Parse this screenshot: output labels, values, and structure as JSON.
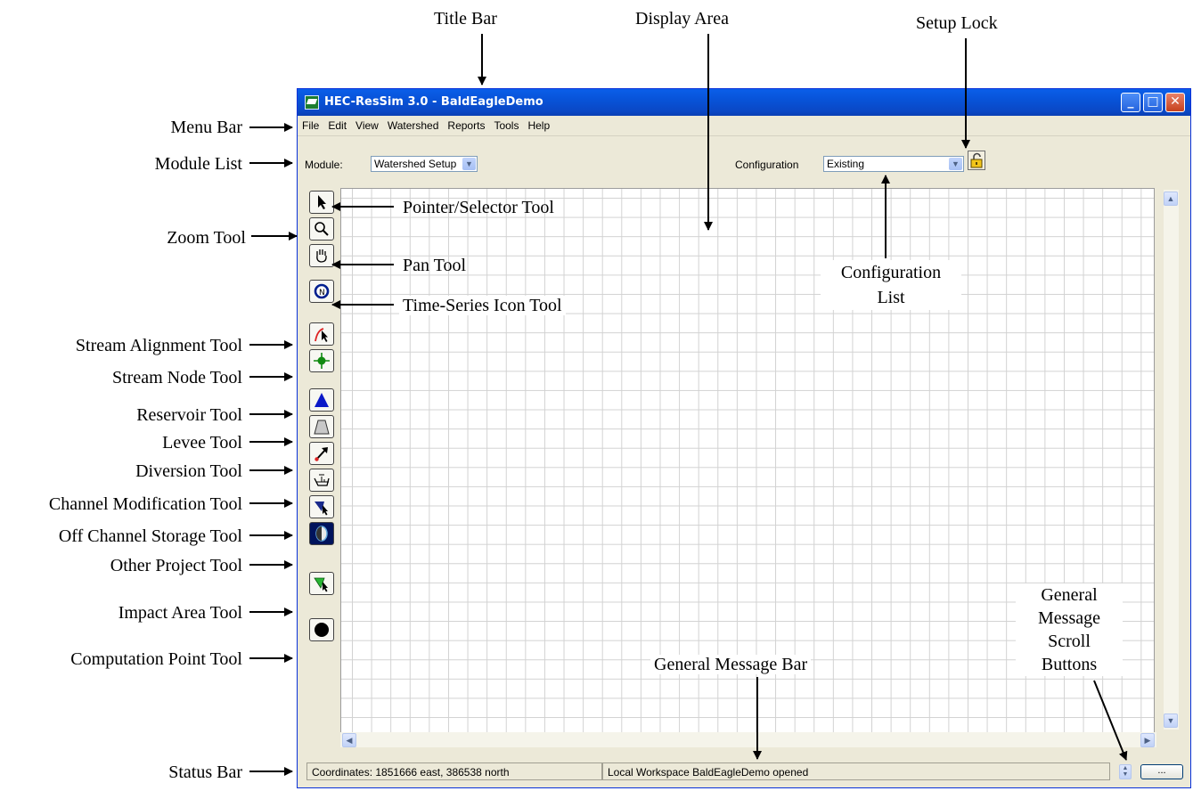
{
  "window": {
    "title": "HEC-ResSim 3.0  - BaldEagleDemo",
    "menu": [
      "File",
      "Edit",
      "View",
      "Watershed",
      "Reports",
      "Tools",
      "Help"
    ],
    "module_label": "Module:",
    "module_value": "Watershed Setup",
    "configuration_label": "Configuration",
    "configuration_value": "Existing",
    "status_coordinates": "Coordinates: 1851666 east, 386538 north",
    "status_message": "Local Workspace BaldEagleDemo opened",
    "ellipsis_label": "...",
    "tools": [
      "pointer-icon",
      "zoom-icon",
      "pan-hand-icon",
      "time-series-icon",
      "stream-alignment-icon",
      "stream-node-icon",
      "reservoir-icon",
      "levee-icon",
      "diversion-icon",
      "channel-modification-icon",
      "off-channel-storage-icon",
      "other-project-icon",
      "impact-area-icon",
      "computation-point-icon"
    ]
  },
  "callouts": {
    "title_bar": "Title Bar",
    "display_area": "Display Area",
    "setup_lock": "Setup Lock",
    "menu_bar": "Menu Bar",
    "module_list": "Module List",
    "pointer_tool": "Pointer/Selector Tool",
    "zoom_tool": "Zoom Tool",
    "pan_tool": "Pan Tool",
    "configuration_list_line1": "Configuration",
    "configuration_list_line2": "List",
    "time_series_tool": "Time-Series Icon Tool",
    "stream_alignment_tool": "Stream Alignment Tool",
    "stream_node_tool": "Stream Node Tool",
    "reservoir_tool": "Reservoir Tool",
    "levee_tool": "Levee Tool",
    "diversion_tool": "Diversion Tool",
    "channel_modification_tool": "Channel Modification Tool",
    "off_channel_storage_tool": "Off Channel Storage Tool",
    "other_project_tool": "Other Project Tool",
    "impact_area_tool": "Impact Area Tool",
    "computation_point_tool": "Computation Point Tool",
    "general_message_bar": "General Message Bar",
    "scroll_buttons_l1": "General",
    "scroll_buttons_l2": "Message",
    "scroll_buttons_l3": "Scroll",
    "scroll_buttons_l4": "Buttons",
    "status_bar": "Status Bar"
  },
  "colors": {
    "titlebar": "#0a52d8",
    "window_bg": "#ece9d8",
    "grid": "#d2d2d2"
  }
}
